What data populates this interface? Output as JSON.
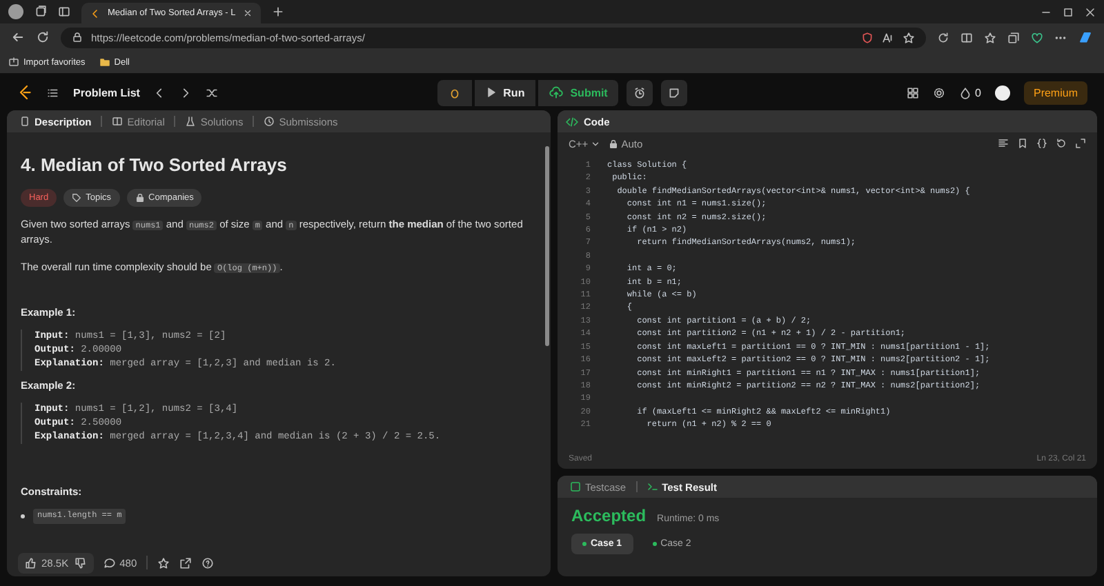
{
  "browser": {
    "tab_title": "Median of Two Sorted Arrays - L",
    "url": "https://leetcode.com/problems/median-of-two-sorted-arrays/",
    "bookmarks": [
      "Import favorites",
      "Dell"
    ]
  },
  "nav": {
    "problem_list": "Problem List",
    "run": "Run",
    "submit": "Submit",
    "streak": "0",
    "premium": "Premium"
  },
  "description_tabs": [
    {
      "label": "Description",
      "selected": true
    },
    {
      "label": "Editorial",
      "selected": false
    },
    {
      "label": "Solutions",
      "selected": false
    },
    {
      "label": "Submissions",
      "selected": false
    }
  ],
  "problem": {
    "title": "4. Median of Two Sorted Arrays",
    "difficulty": "Hard",
    "tags": [
      "Topics",
      "Companies"
    ],
    "paragraphs": [
      [
        {
          "kind": "text",
          "text": "Given two sorted arrays "
        },
        {
          "kind": "code",
          "text": "nums1"
        },
        {
          "kind": "text",
          "text": " and "
        },
        {
          "kind": "code",
          "text": "nums2"
        },
        {
          "kind": "text",
          "text": " of size "
        },
        {
          "kind": "code",
          "text": "m"
        },
        {
          "kind": "text",
          "text": " and "
        },
        {
          "kind": "code",
          "text": "n"
        },
        {
          "kind": "text",
          "text": " respectively, return "
        },
        {
          "kind": "bold",
          "text": "the median"
        },
        {
          "kind": "text",
          "text": " of the two sorted arrays."
        }
      ],
      [
        {
          "kind": "text",
          "text": "The overall run time complexity should be "
        },
        {
          "kind": "code",
          "text": "O(log (m+n))"
        },
        {
          "kind": "text",
          "text": "."
        }
      ]
    ],
    "examples": [
      {
        "heading": "Example 1:",
        "lines": [
          {
            "label": "Input:",
            "value": "nums1 = [1,3], nums2 = [2]"
          },
          {
            "label": "Output:",
            "value": "2.00000"
          },
          {
            "label": "Explanation:",
            "value": "merged array = [1,2,3] and median is 2."
          }
        ]
      },
      {
        "heading": "Example 2:",
        "lines": [
          {
            "label": "Input:",
            "value": "nums1 = [1,2], nums2 = [3,4]"
          },
          {
            "label": "Output:",
            "value": "2.50000"
          },
          {
            "label": "Explanation:",
            "value": "merged array = [1,2,3,4] and median is (2 + 3) / 2 = 2.5."
          }
        ]
      }
    ],
    "constraints_heading": "Constraints:",
    "constraints": [
      "nums1.length == m"
    ],
    "likes": "28.5K",
    "comments": "480"
  },
  "code": {
    "tab": "Code",
    "language": "C++",
    "mode": "Auto",
    "lines": [
      {
        "number": "1",
        "text": "class Solution {"
      },
      {
        "number": "2",
        "text": " public:"
      },
      {
        "number": "3",
        "text": "  double findMedianSortedArrays(vector<int>& nums1, vector<int>& nums2) {"
      },
      {
        "number": "4",
        "text": "    const int n1 = nums1.size();"
      },
      {
        "number": "5",
        "text": "    const int n2 = nums2.size();"
      },
      {
        "number": "6",
        "text": "    if (n1 > n2)"
      },
      {
        "number": "7",
        "text": "      return findMedianSortedArrays(nums2, nums1);"
      },
      {
        "number": "8"
      },
      {
        "number": "9",
        "text": "    int a = 0;"
      },
      {
        "number": "10",
        "text": "    int b = n1;"
      },
      {
        "number": "11",
        "text": "    while (a <= b)"
      },
      {
        "number": "12",
        "text": "    {"
      },
      {
        "number": "13",
        "text": "      const int partition1 = (a + b) / 2;"
      },
      {
        "number": "14",
        "text": "      const int partition2 = (n1 + n2 + 1) / 2 - partition1;"
      },
      {
        "number": "15",
        "text": "      const int maxLeft1 = partition1 == 0 ? INT_MIN : nums1[partition1 - 1];"
      },
      {
        "number": "16",
        "text": "      const int maxLeft2 = partition2 == 0 ? INT_MIN : nums2[partition2 - 1];"
      },
      {
        "number": "17",
        "text": "      const int minRight1 = partition1 == n1 ? INT_MAX : nums1[partition1];"
      },
      {
        "number": "18",
        "text": "      const int minRight2 = partition2 == n2 ? INT_MAX : nums2[partition2];"
      },
      {
        "number": "19"
      },
      {
        "number": "20",
        "text": "      if (maxLeft1 <= minRight2 && maxLeft2 <= minRight1)"
      },
      {
        "number": "21",
        "text": "        return (n1 + n2) % 2 == 0"
      }
    ],
    "status": "Saved",
    "position": "Ln 23, Col 21"
  },
  "result_tabs": [
    {
      "label": "Testcase",
      "selected": false
    },
    {
      "label": "Test Result",
      "selected": true
    }
  ],
  "result": {
    "verdict": "Accepted",
    "runtime": "Runtime: 0 ms",
    "cases": [
      {
        "label": "Case 1",
        "selected": true
      },
      {
        "label": "Case 2",
        "selected": false
      }
    ]
  }
}
